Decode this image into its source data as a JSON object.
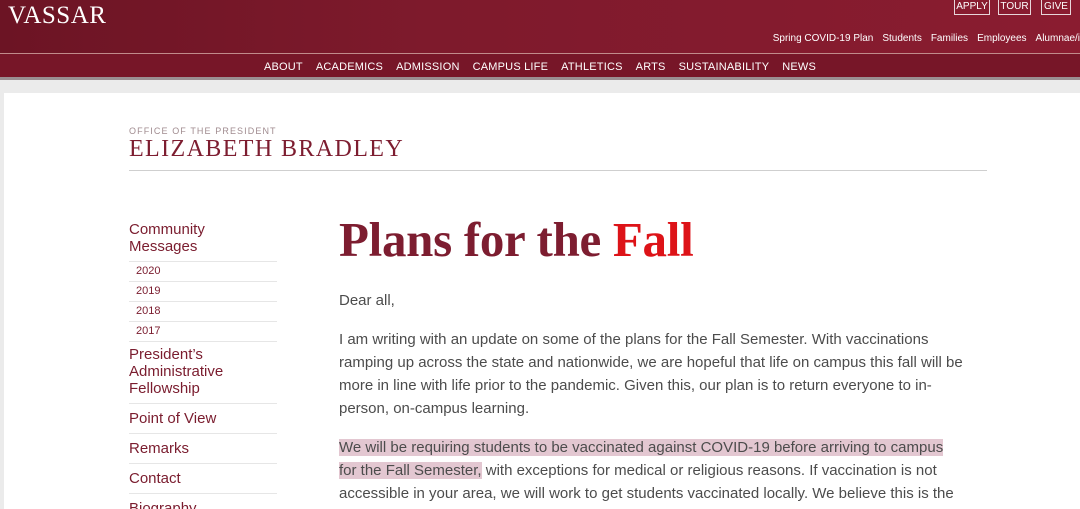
{
  "brand": {
    "logo": "VASSAR"
  },
  "cta": {
    "apply": "APPLY",
    "tour": "TOUR",
    "give": "GIVE"
  },
  "utility_nav": [
    "Spring COVID-19 Plan",
    "Students",
    "Families",
    "Employees",
    "Alumnae/i"
  ],
  "main_nav": [
    "ABOUT",
    "ACADEMICS",
    "ADMISSION",
    "CAMPUS LIFE",
    "ATHLETICS",
    "ARTS",
    "SUSTAINABILITY",
    "NEWS"
  ],
  "office": {
    "kicker": "OFFICE OF THE PRESIDENT",
    "name": "ELIZABETH BRADLEY"
  },
  "sidebar": {
    "heading": "Community Messages",
    "years": [
      "2020",
      "2019",
      "2018",
      "2017"
    ],
    "items": [
      "President’s Administrative Fellowship",
      "Point of View",
      "Remarks",
      "Contact",
      "Biography"
    ]
  },
  "article": {
    "title_part1": "Plans for the ",
    "title_part2": "Fall",
    "salutation": "Dear all,",
    "para1": "I am writing with an update on some of the plans for the Fall Semester. With vaccinations ramping up across the state and nationwide, we are hopeful that life on campus this fall will be more in line with life prior to the pandemic. Given this, our plan is to return everyone to in-person, on-campus learning.",
    "para2_highlight": "We will be requiring students to be vaccinated against COVID-19 before arriving to campus for the Fall Semester,",
    "para2_rest": " with exceptions for medical or religious reasons. If vaccination is not accessible in your area, we will work to get students vaccinated locally. We believe this is the best way to"
  },
  "colors": {
    "brand_maroon": "#7d1d30",
    "title_red": "#dd1318",
    "highlight": "#e3c7d1"
  }
}
